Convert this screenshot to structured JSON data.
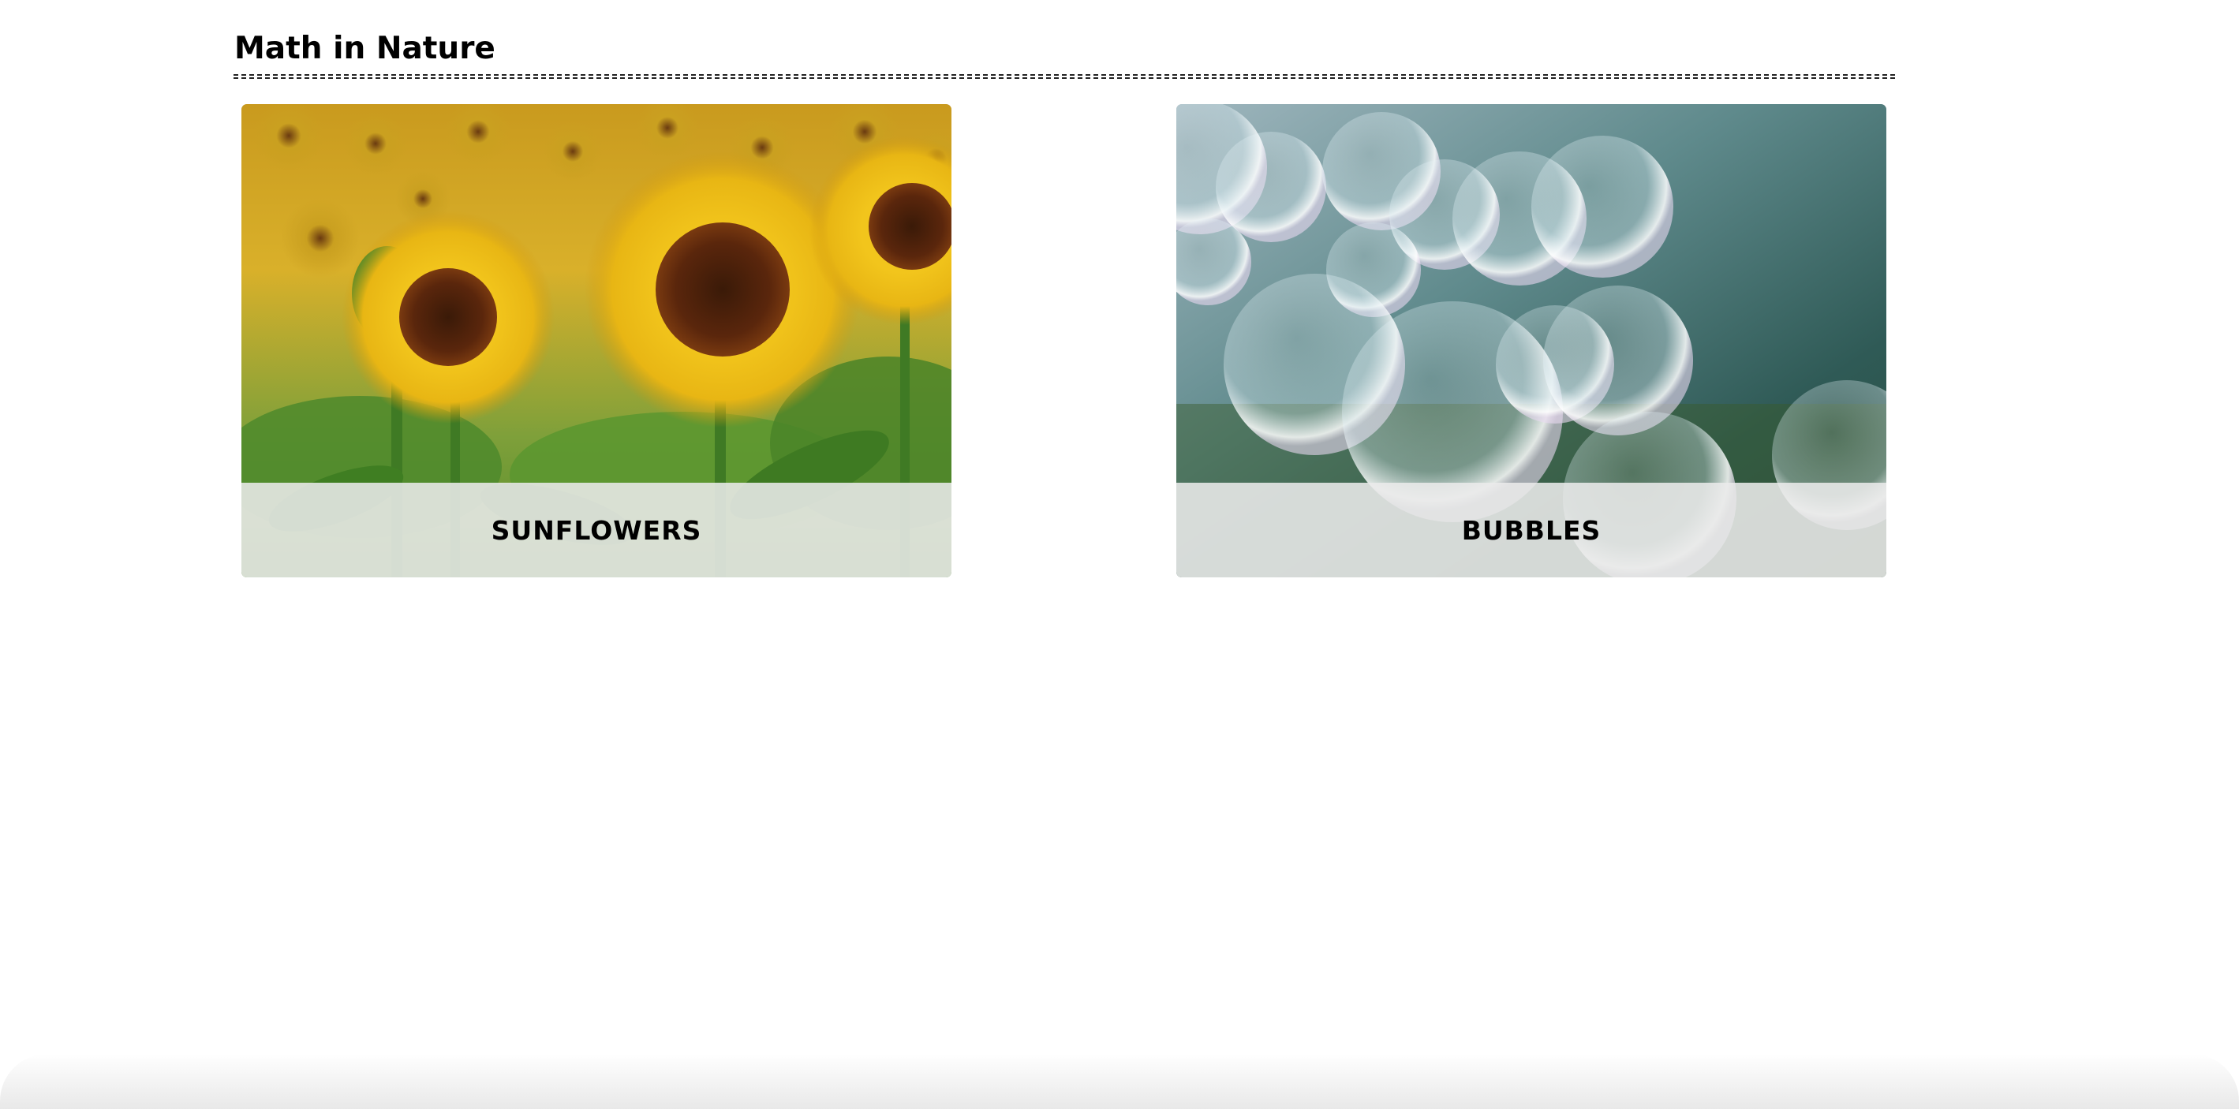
{
  "page": {
    "title": "Math in Nature"
  },
  "cards": [
    {
      "label": "SUNFLOWERS",
      "image_subject": "sunflower-field-photo"
    },
    {
      "label": "BUBBLES",
      "image_subject": "soap-bubbles-photo"
    }
  ],
  "colors": {
    "caption_background": "#ebebeb",
    "text": "#000000",
    "rule": "#222222"
  }
}
